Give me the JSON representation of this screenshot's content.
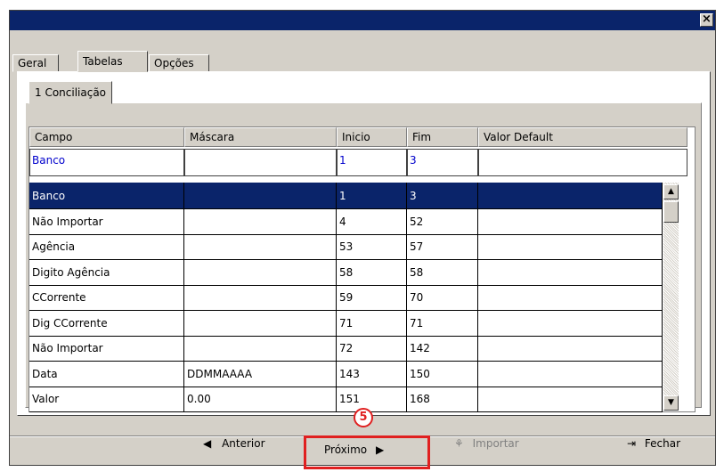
{
  "window": {
    "close_label": "×"
  },
  "tabs": [
    "Geral",
    "Tabelas",
    "Opções"
  ],
  "subtab": "1 Conciliação",
  "grid": {
    "headers": [
      "Campo",
      "Máscara",
      "Inicio",
      "Fim",
      "Valor Default"
    ],
    "edit_row": [
      "Banco",
      "",
      "1",
      "3",
      ""
    ],
    "rows": [
      [
        "Banco",
        "",
        "1",
        "3",
        ""
      ],
      [
        "Não Importar",
        "",
        "4",
        "52",
        ""
      ],
      [
        "Agência",
        "",
        "53",
        "57",
        ""
      ],
      [
        "Digito Agência",
        "",
        "58",
        "58",
        ""
      ],
      [
        "CCorrente",
        "",
        "59",
        "70",
        ""
      ],
      [
        "Dig CCorrente",
        "",
        "71",
        "71",
        ""
      ],
      [
        "Não Importar",
        "",
        "72",
        "142",
        ""
      ],
      [
        "Data",
        "DDMMAAAA",
        "143",
        "150",
        ""
      ],
      [
        "Valor",
        "0.00",
        "151",
        "168",
        ""
      ]
    ]
  },
  "buttons": {
    "anterior": "Anterior",
    "proximo": "Próximo",
    "importar": "Importar",
    "fechar": "Fechar"
  },
  "callout": "5",
  "colors": {
    "titlebar": "#0a246a",
    "selection": "#0a246a",
    "highlight": "#e02020"
  }
}
